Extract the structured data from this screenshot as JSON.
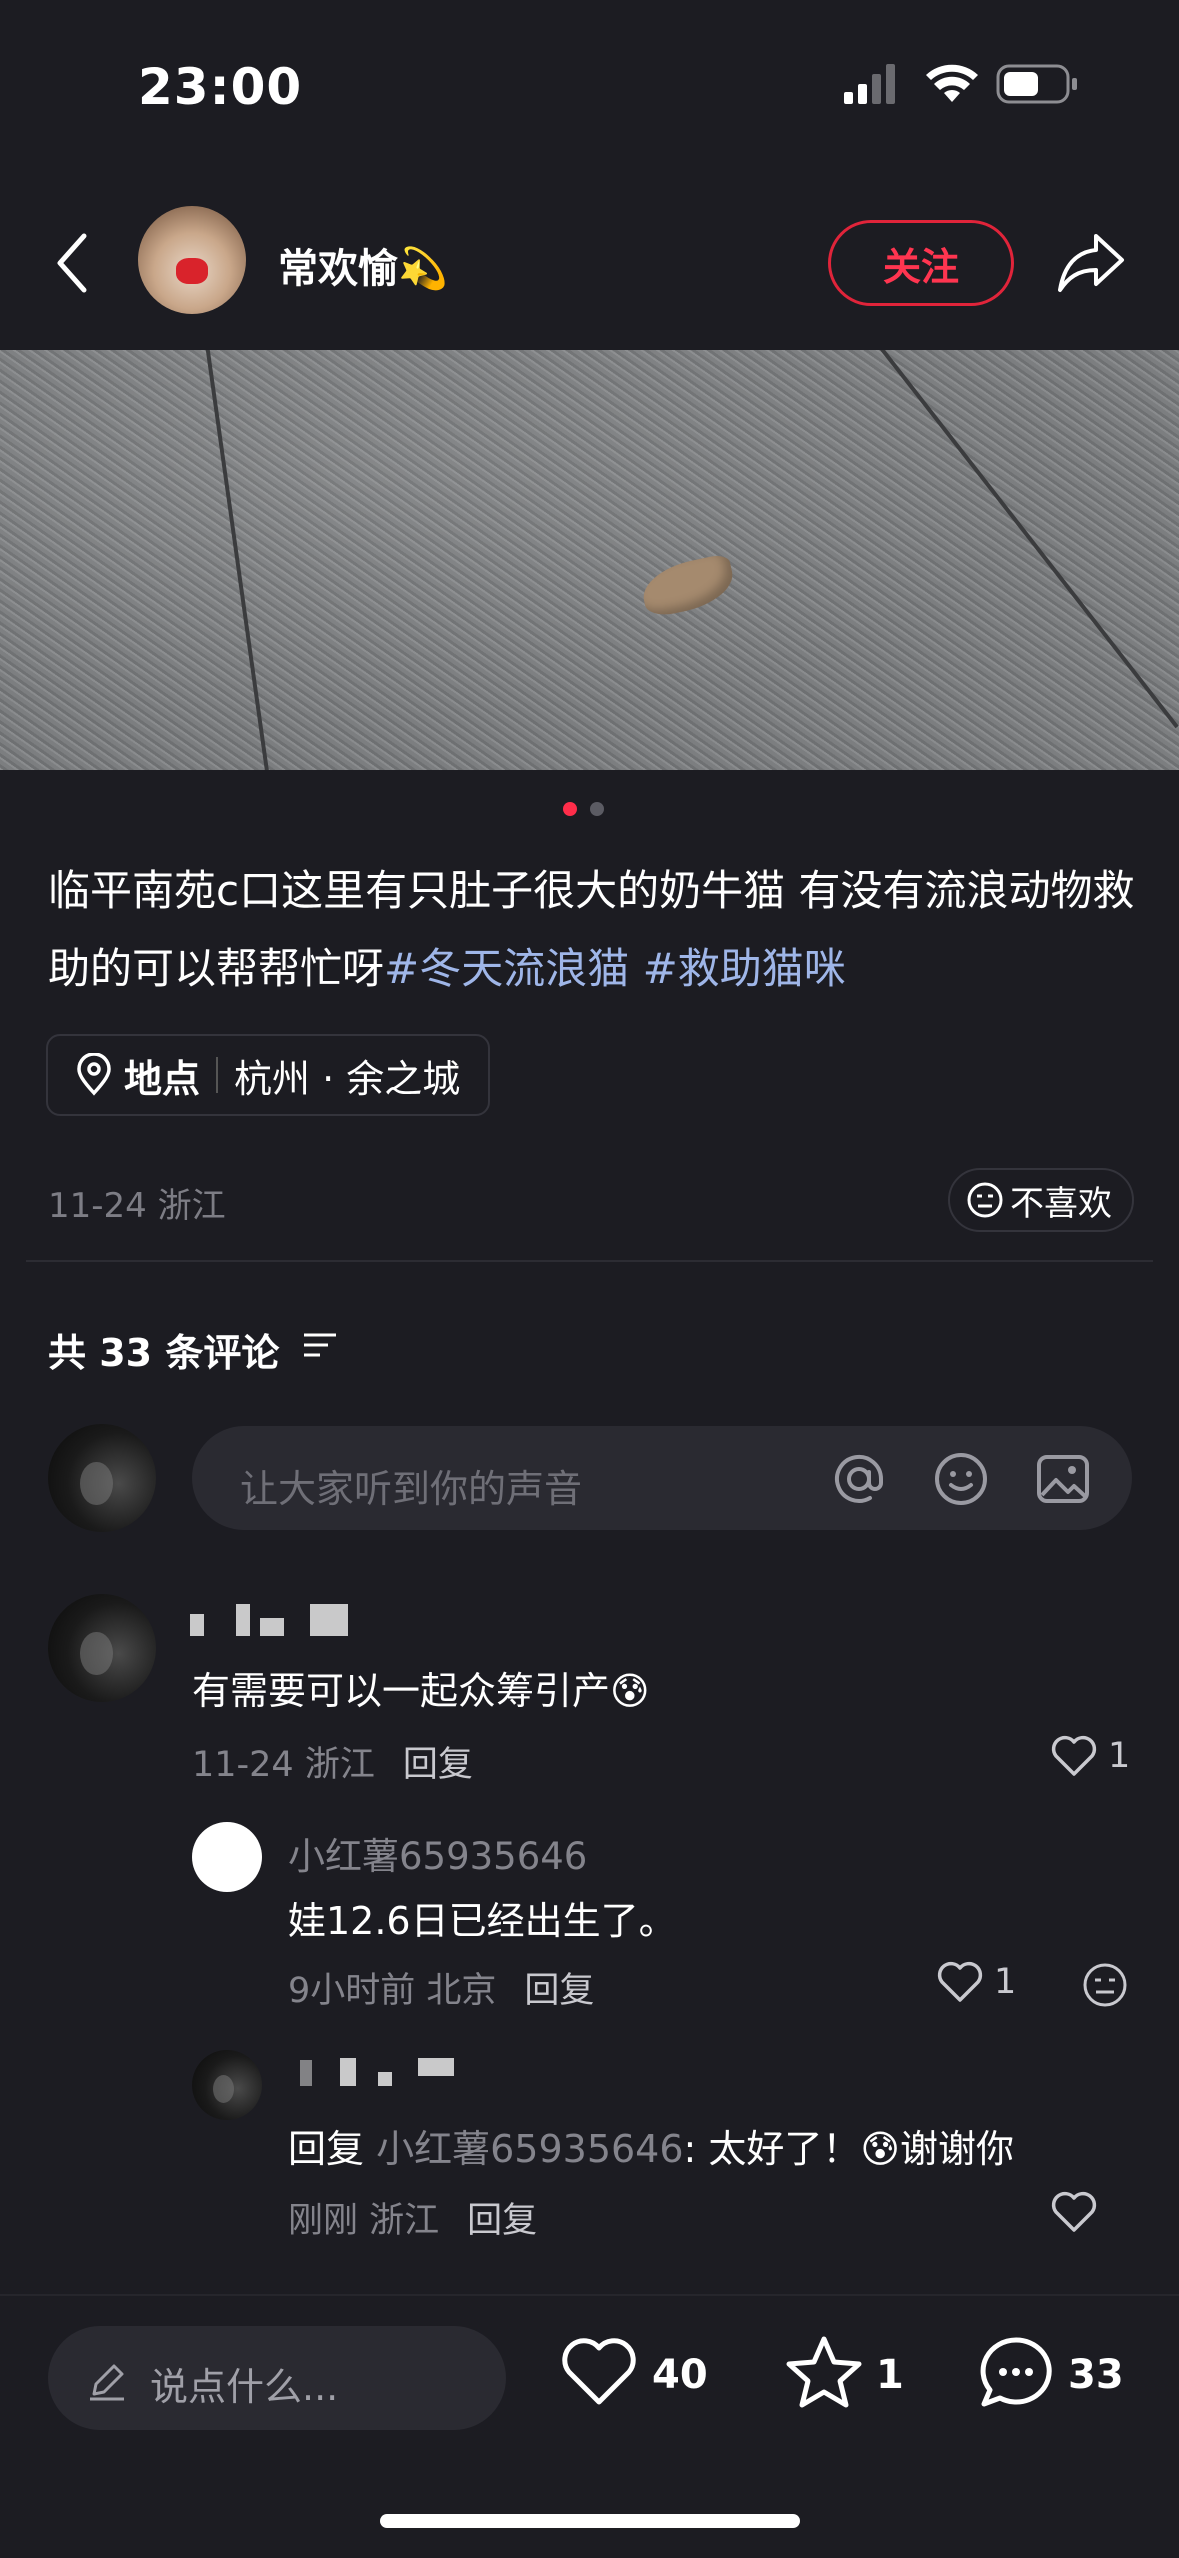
{
  "status_bar": {
    "time": "23:00"
  },
  "header": {
    "author": "常欢愉",
    "author_emoji": "💫",
    "follow_label": "关注"
  },
  "post": {
    "text": "临平南苑c口这里有只肚子很大的奶牛猫  有没有流浪动物救助的可以帮帮忙呀",
    "tags": [
      "#冬天流浪猫",
      "#救助猫咪"
    ],
    "location_label": "地点",
    "location_value": "杭州 · 余之城",
    "date": "11-24 浙江",
    "dislike_label": "不喜欢",
    "image_index": 1,
    "image_count": 2
  },
  "comments_header": {
    "title": "共 33 条评论"
  },
  "input": {
    "placeholder": "让大家听到你的声音"
  },
  "comments": [
    {
      "text": "有需要可以一起众筹引产",
      "emoji": "😰",
      "date": "11-24 浙江",
      "reply_label": "回复",
      "likes": "1"
    },
    {
      "user": "小红薯65935646",
      "text": "娃12.6日已经出生了。",
      "date": "9小时前 北京",
      "reply_label": "回复",
      "likes": "1"
    },
    {
      "reply_prefix": "回复",
      "reply_to": "小红薯65935646",
      "text_1": ": 太好了！",
      "emoji": "😰",
      "text_2": "谢谢你",
      "date": "刚刚 浙江",
      "reply_label": "回复"
    }
  ],
  "bottom_bar": {
    "say_placeholder": "说点什么...",
    "likes": "40",
    "stars": "1",
    "comments": "33"
  },
  "colors": {
    "background": "#1c1c22",
    "accent": "#e0243a",
    "hashtag": "#9fb6e8",
    "muted": "#84848c"
  }
}
